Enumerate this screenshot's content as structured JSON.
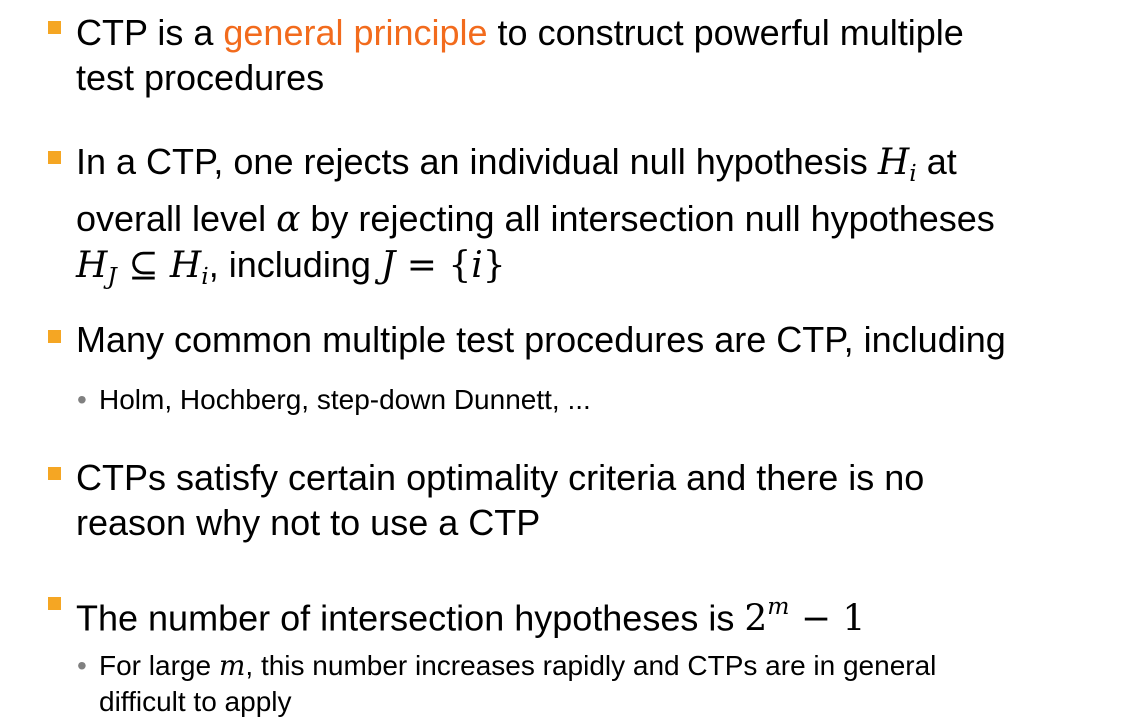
{
  "colors": {
    "accent": "#f26b1d",
    "bullet_marker": "#f5a623",
    "sub_bullet": "#808080"
  },
  "b1": {
    "pre": "CTP is a ",
    "highlight": "general principle",
    "post": " to construct powerful multiple",
    "line2": "test procedures"
  },
  "b2": {
    "l1_pre": "In a CTP, one rejects an individual null hypothesis ",
    "H": "H",
    "i": "i",
    "l1_post": " at",
    "l2_pre": "overall level ",
    "alpha": "α",
    "l2_post": " by rejecting all intersection null hypotheses",
    "HJ": "H",
    "J": "J",
    "subseteq": " ⊆ ",
    "Hi": "H",
    "i2": "i",
    "l3_mid": ", including ",
    "Jvar": "J",
    "eq": " = {",
    "ivar": "i",
    "close": "}"
  },
  "b3": {
    "text": "Many common multiple test procedures are CTP, including",
    "sub": "Holm, Hochberg, step-down Dunnett, ..."
  },
  "b4": {
    "line1": "CTPs satisfy certain optimality criteria and there is no",
    "line2": "reason why not to use a CTP"
  },
  "b5": {
    "pre": "The number of intersection hypotheses is ",
    "base": "2",
    "exp": "m",
    "tail": " − 1",
    "sub_pre": "For large ",
    "sub_m": "m",
    "sub_post": ", this number increases rapidly and CTPs are in general",
    "sub_line2": "difficult to apply"
  }
}
